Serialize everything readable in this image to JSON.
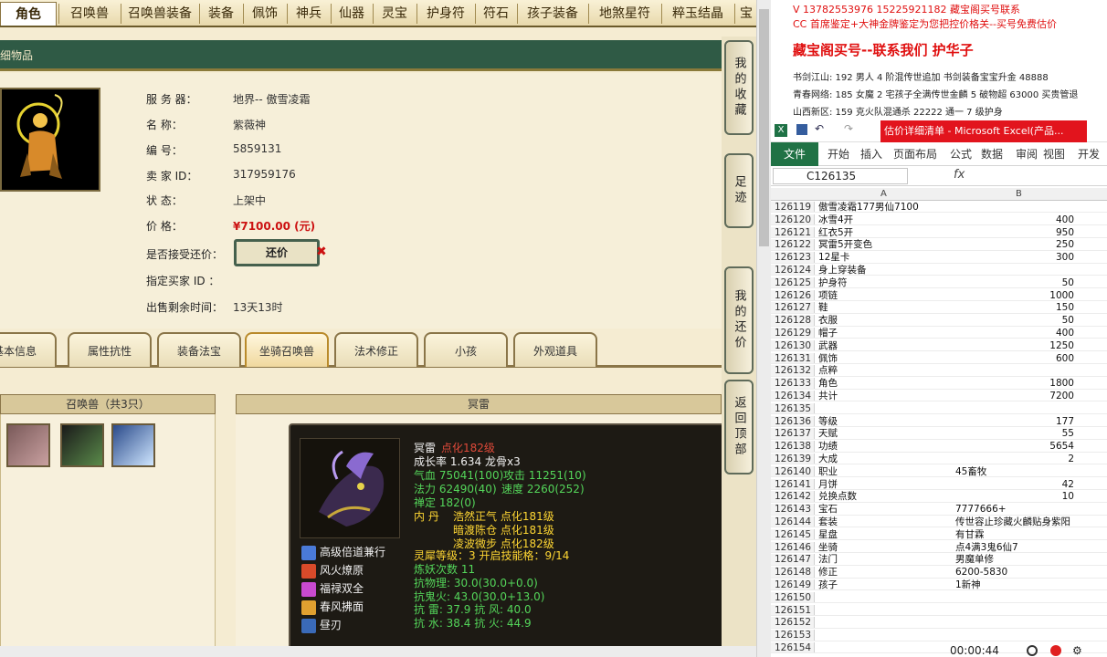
{
  "topnav": {
    "tabs": [
      "角色",
      "召唤兽",
      "召唤兽装备",
      "装备",
      "佩饰",
      "神兵",
      "仙器",
      "灵宝",
      "护身符",
      "符石",
      "孩子装备",
      "地煞星符",
      "粹玉结晶",
      "宝"
    ]
  },
  "section_title": "细物品",
  "character": {
    "rows": [
      {
        "label": "服 务 器：",
        "value": "地界-- 傲雪凌霜"
      },
      {
        "label": "名        称：",
        "value": "紫薇神"
      },
      {
        "label": "编        号：",
        "value": "5859131"
      },
      {
        "label": "卖    家    ID：",
        "value": "317959176"
      },
      {
        "label": "状        态：",
        "value": "上架中"
      },
      {
        "label": "价        格：",
        "value": "¥7100.00 (元)"
      },
      {
        "label": "是否接受还价：",
        "value": ""
      },
      {
        "label": "指定买家 ID ：",
        "value": ""
      },
      {
        "label": "出售剩余时间：",
        "value": "13天13时"
      }
    ],
    "counter_button": "还价",
    "counter_x": "✖"
  },
  "subtabs": [
    "基本信息",
    "属性抗性",
    "装备法宝",
    "坐骑召唤兽",
    "法术修正",
    "小孩",
    "外观道具"
  ],
  "pet_list": {
    "title": "召唤兽（共3只）"
  },
  "pet_detail": {
    "title": "冥雷",
    "name": "冥雷",
    "level": "点化182级",
    "growth": "成长率 1.634 龙骨x3",
    "hp": "气血 75041(100)",
    "atk": "攻击 11251(10)",
    "mp": "法力 62490(40)",
    "speed": "速度 2260(252)",
    "fixed": "禅定 182(0)",
    "dan_label": "内    丹",
    "dan": [
      "浩然正气 点化181级",
      "暗渡陈仓 点化181级",
      "凌波微步 点化182级"
    ],
    "skills": [
      "高级倍道兼行",
      "风火燎原",
      "福禄双全",
      "春风拂面",
      "昼刃"
    ],
    "spirit": "灵犀等级：3 开启技能格：9/14",
    "refine": "炼妖次数 11",
    "res_phys": "抗物理: 30.0(30.0+0.0)",
    "res_ghost": "抗鬼火: 43.0(30.0+13.0)",
    "res_row1": "抗    雷: 37.9 抗    风: 40.0",
    "res_row2": "抗    水: 38.4 抗    火: 44.9",
    "colors": {
      "red": "#e04a3a",
      "yellow": "#ffd733",
      "green": "#54d65a"
    }
  },
  "side_buttons": [
    "我的收藏",
    "足迹",
    "我的还价",
    "返回顶部"
  ],
  "doc": {
    "line1": "V 13782553976   15225921182   藏宝阁买号联系",
    "line2": "CC 首席鉴定+大神金牌鉴定为您把控价格关--买号免费估价",
    "headline": "藏宝阁买号--联系我们 护华子",
    "line3": "书剑江山: 192 男人 4 阶混传世追加 书剑装备宝宝升金 48888",
    "line4": "青春网络: 185 女魔 2 宅孩子全满传世金麟 5 破物超 63000 买贵管退",
    "line5": "山西新区: 159 克火队混通杀 22222 通一 7 级护身"
  },
  "excel": {
    "window_title": "估价详细清单 - Microsoft Excel(产品...",
    "file_tab": "文件",
    "tabs": [
      "开始",
      "插入",
      "页面布局",
      "公式",
      "数据",
      "审阅",
      "视图",
      "开发工"
    ],
    "namebox": "C126135",
    "fx": "fx",
    "col_a": "A",
    "col_b": "B",
    "rows": [
      {
        "n": "126119",
        "a": "傲雪凌霜177男仙7100",
        "b": ""
      },
      {
        "n": "126120",
        "a": "冰雪4开",
        "b": "400"
      },
      {
        "n": "126121",
        "a": "红衣5开",
        "b": "950"
      },
      {
        "n": "126122",
        "a": "冥雷5开变色",
        "b": "250"
      },
      {
        "n": "126123",
        "a": "12星卡",
        "b": "300"
      },
      {
        "n": "126124",
        "a": "身上穿装备",
        "b": ""
      },
      {
        "n": "126125",
        "a": "护身符",
        "b": "50"
      },
      {
        "n": "126126",
        "a": "项链",
        "b": "1000"
      },
      {
        "n": "126127",
        "a": "鞋",
        "b": "150"
      },
      {
        "n": "126128",
        "a": "衣服",
        "b": "50"
      },
      {
        "n": "126129",
        "a": "帽子",
        "b": "400"
      },
      {
        "n": "126130",
        "a": "武器",
        "b": "1250"
      },
      {
        "n": "126131",
        "a": "佩饰",
        "b": "600"
      },
      {
        "n": "126132",
        "a": "点粹",
        "b": ""
      },
      {
        "n": "126133",
        "a": "角色",
        "b": "1800"
      },
      {
        "n": "126134",
        "a": "共计",
        "b": "7200"
      },
      {
        "n": "126135",
        "a": "",
        "b": ""
      },
      {
        "n": "126136",
        "a": "等级",
        "b": "177"
      },
      {
        "n": "126137",
        "a": "天赋",
        "b": "55"
      },
      {
        "n": "126138",
        "a": "功绩",
        "b": "5654"
      },
      {
        "n": "126139",
        "a": "大成",
        "b": "2"
      },
      {
        "n": "126140",
        "a": "职业",
        "b": "45畜牧"
      },
      {
        "n": "126141",
        "a": "月饼",
        "b": "42"
      },
      {
        "n": "126142",
        "a": "兑换点数",
        "b": "10"
      },
      {
        "n": "126143",
        "a": "宝石",
        "b": "7777666+"
      },
      {
        "n": "126144",
        "a": "套装",
        "b": "传世容止珍藏火麟贴身紫阳"
      },
      {
        "n": "126145",
        "a": "星盘",
        "b": "有甘霖"
      },
      {
        "n": "126146",
        "a": "坐骑",
        "b": "点4满3鬼6仙7"
      },
      {
        "n": "126147",
        "a": "法门",
        "b": "男魔单修"
      },
      {
        "n": "126148",
        "a": "修正",
        "b": "6200-5830"
      },
      {
        "n": "126149",
        "a": "孩子",
        "b": "1新神"
      },
      {
        "n": "126150",
        "a": "",
        "b": ""
      },
      {
        "n": "126151",
        "a": "",
        "b": ""
      },
      {
        "n": "126152",
        "a": "",
        "b": ""
      },
      {
        "n": "126153",
        "a": "",
        "b": ""
      },
      {
        "n": "126154",
        "a": "",
        "b": ""
      }
    ]
  },
  "recorder": {
    "time": "00:00:44"
  }
}
